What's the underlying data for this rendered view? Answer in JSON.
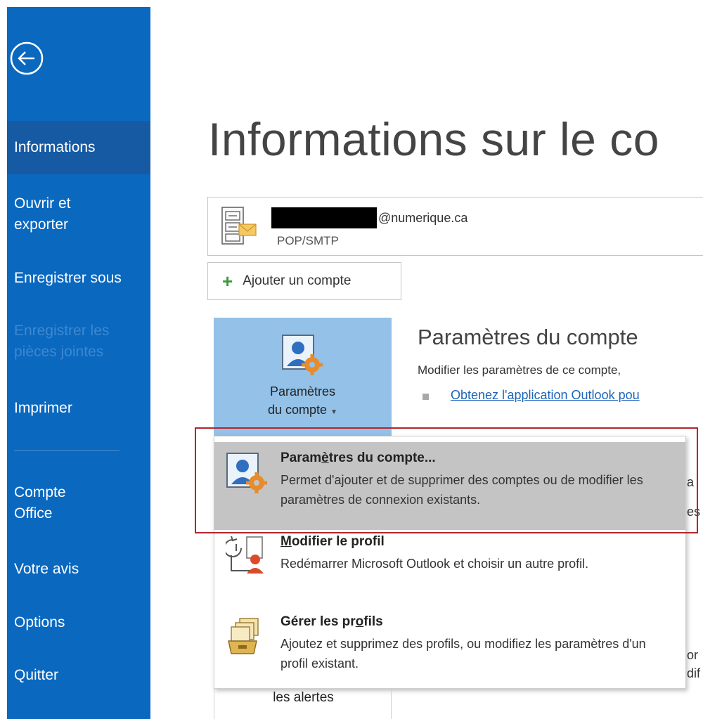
{
  "sidebar": {
    "back_label": "Back",
    "items": [
      {
        "label": "Informations"
      },
      {
        "label": "Ouvrir et exporter"
      },
      {
        "label": "Enregistrer sous"
      },
      {
        "label": "Enregistrer les pièces jointes"
      },
      {
        "label": "Imprimer"
      },
      {
        "label": "Compte Office"
      },
      {
        "label": "Votre avis"
      },
      {
        "label": "Options"
      },
      {
        "label": "Quitter"
      }
    ]
  },
  "main": {
    "title": "Informations sur le co",
    "account": {
      "email_domain": "@numerique.ca",
      "type": "POP/SMTP"
    },
    "add_account_label": "Ajouter un compte",
    "settings_tile": {
      "line1": "Paramètres",
      "line2": "du compte"
    },
    "section": {
      "heading": "Paramètres du compte",
      "description": "Modifier les paramètres de ce compte,",
      "link": "Obtenez l'application Outlook pou"
    },
    "alerts_label": "les alertes",
    "clipped": {
      "a": "a",
      "b": "es",
      "c": "or",
      "d": "dif"
    }
  },
  "dropdown": {
    "items": [
      {
        "title_pre": "Param",
        "title_ul": "è",
        "title_post": "tres du compte...",
        "desc": "Permet d'ajouter et de supprimer des comptes ou de modifier les paramètres de connexion existants."
      },
      {
        "title_ul": "M",
        "title_post": "odifier le profil",
        "desc": "Redémarrer Microsoft Outlook et choisir un autre profil."
      },
      {
        "title_pre": "Gérer les pr",
        "title_ul": "o",
        "title_post": "fils",
        "desc": "Ajoutez et supprimez des profils, ou modifiez les paramètres d'un profil existant."
      }
    ]
  },
  "colors": {
    "sidebar": "#0a68bf",
    "sidebar_active": "#175aa4",
    "tile": "#94c1e7",
    "highlight": "#c4c4c4",
    "red_outline": "#b3262d",
    "link": "#1d63b8"
  }
}
